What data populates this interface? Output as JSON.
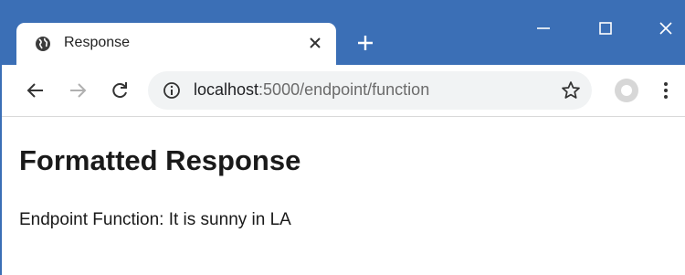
{
  "tab": {
    "title": "Response",
    "favicon": "globe-icon"
  },
  "address_bar": {
    "host": "localhost",
    "path": ":5000/endpoint/function"
  },
  "page": {
    "heading": "Formatted Response",
    "text": "Endpoint Function: It is sunny in LA"
  },
  "colors": {
    "titlebar": "#3b6fb6",
    "omnibox": "#f1f3f4"
  }
}
